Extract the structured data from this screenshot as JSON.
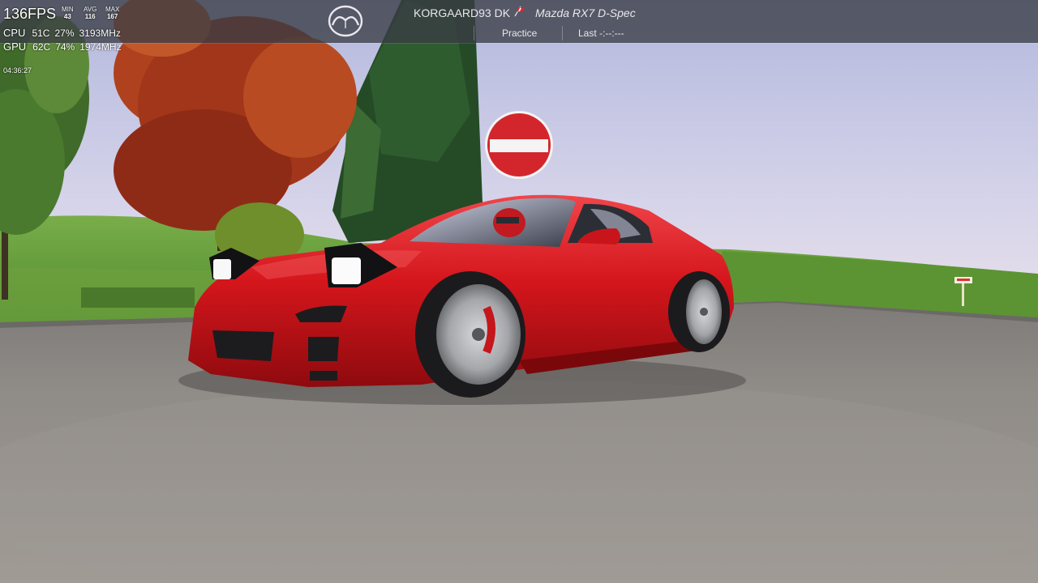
{
  "hud": {
    "fps": "136FPS",
    "fps_stats": [
      {
        "label": "MIN",
        "value": "43"
      },
      {
        "label": "AVG",
        "value": "116"
      },
      {
        "label": "MAX",
        "value": "167"
      }
    ],
    "cpu": {
      "label": "CPU",
      "temp": "51C",
      "load": "27%",
      "clock": "3193MHz"
    },
    "gpu": {
      "label": "GPU",
      "temp": "62C",
      "load": "74%",
      "clock": "1974MHz"
    },
    "time": "04:36:27"
  },
  "topbar": {
    "logo": "mazda-logo-icon",
    "driver_name": "KORGAARD93 DK",
    "flag_icon": "flag-icon",
    "car_name": "Mazda RX7 D-Spec",
    "session": "Practice",
    "last_lap": "Last -:--:---"
  },
  "colors": {
    "hud_bar": "#3a3c44",
    "car_red": "#d0141a",
    "sky_top": "#b9bfe2",
    "grass": "#5f9a3a",
    "asphalt": "#8d8a86"
  }
}
